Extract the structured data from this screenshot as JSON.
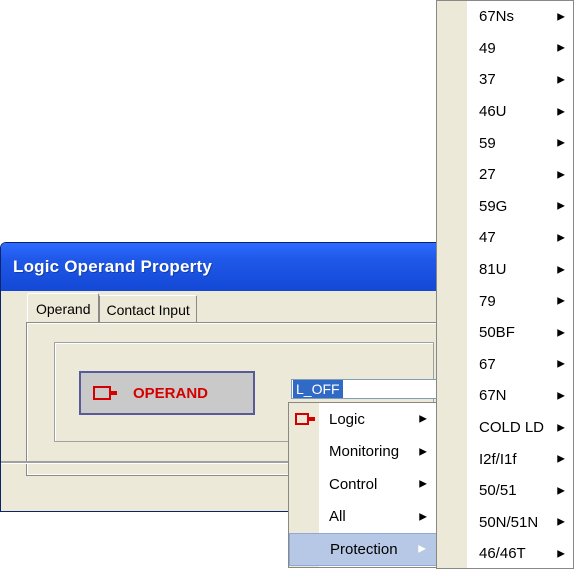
{
  "dialog": {
    "title": "Logic Operand Property",
    "tabs": [
      {
        "label": "Operand",
        "active": true
      },
      {
        "label": "Contact Input",
        "active": false
      }
    ],
    "operand_tile": {
      "label": "OPERAND",
      "icon": "operand-output-icon",
      "label_color": "#d40000"
    },
    "operand_value": "L_OFF"
  },
  "context_menu": {
    "items": [
      {
        "label": "Logic",
        "has_submenu": true,
        "icon": "operand-output-icon"
      },
      {
        "label": "Monitoring",
        "has_submenu": true
      },
      {
        "label": "Control",
        "has_submenu": true
      },
      {
        "label": "All",
        "has_submenu": true
      },
      {
        "label": "Protection",
        "has_submenu": true,
        "highlighted": true
      }
    ]
  },
  "protection_submenu": {
    "items": [
      "67Ns",
      "49",
      "37",
      "46U",
      "59",
      "27",
      "59G",
      "47",
      "81U",
      "79",
      "50BF",
      "67",
      "67N",
      "COLD LD",
      "I2f/I1f",
      "50/51",
      "50N/51N",
      "46/46T"
    ]
  },
  "colors": {
    "titlebar": "#1f58e8",
    "highlight": "#316ac5",
    "menu_highlight": "#b6c8e6",
    "operand_red": "#d40000"
  }
}
